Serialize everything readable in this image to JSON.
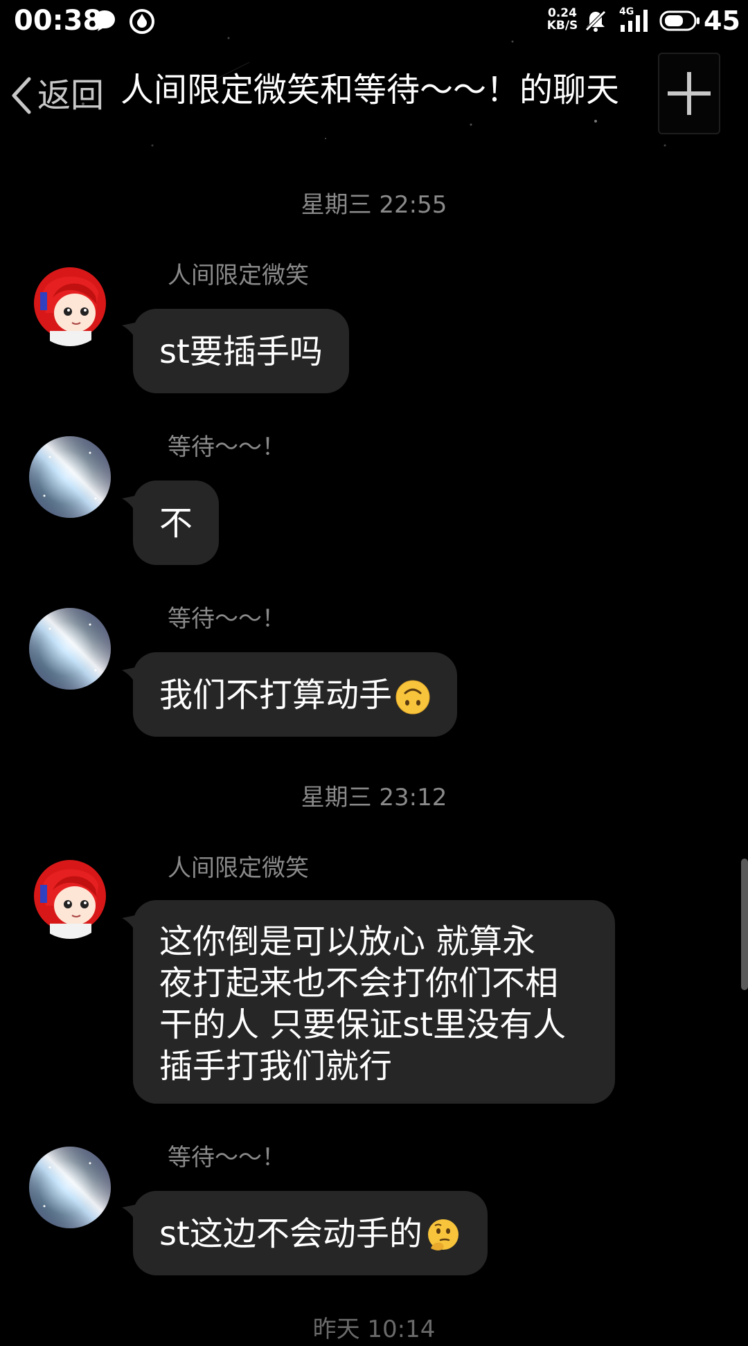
{
  "status_bar": {
    "time": "00:38",
    "net_speed_value": "0.24",
    "net_speed_unit": "KB/S",
    "network_type": "4G",
    "battery": "45"
  },
  "header": {
    "back_label": "返回",
    "title": "人间限定微笑和等待～～！的聊天"
  },
  "messages": [
    {
      "sender": "人间限定微笑",
      "avatar": "red-hair-avatar",
      "text": "st要插手吗"
    },
    {
      "sender": "等待～～！",
      "avatar": "galaxy-avatar",
      "text": "不"
    },
    {
      "sender": "等待～～！",
      "avatar": "galaxy-avatar",
      "text": "我们不打算动手",
      "emoji": "upside-down-face"
    },
    {
      "sender": "人间限定微笑",
      "avatar": "red-hair-avatar",
      "lines": [
        "这你倒是可以放心 就算永",
        "夜打起来也不会打你们不相",
        "干的人 只要保证st里没有人",
        "插手打我们就行"
      ]
    },
    {
      "sender": "等待～～！",
      "avatar": "galaxy-avatar",
      "text": "st这边不会动手的",
      "emoji": "thinking-face"
    }
  ],
  "timestamps": [
    "星期三 22:55",
    "星期三 23:12"
  ],
  "next_timestamp_partial": "昨天 10:14",
  "colors": {
    "background": "#000000",
    "bubble": "#262626",
    "secondary_text": "#8a8a8a"
  }
}
